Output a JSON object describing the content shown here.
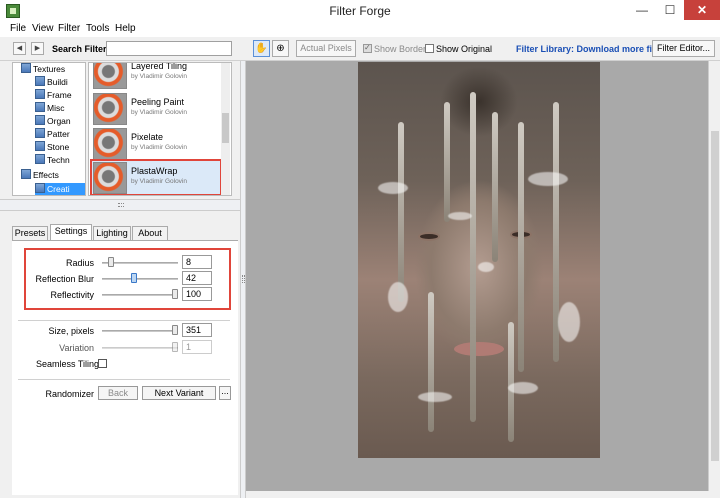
{
  "window": {
    "title": "Filter Forge",
    "minimize": "—",
    "maximize": "☐",
    "close": "✕"
  },
  "menu": [
    "File",
    "View",
    "Filter",
    "Tools",
    "Help"
  ],
  "toolbar": {
    "back_icon": "◀",
    "forward_icon": "▶",
    "search_label": "Search Filters:",
    "search_value": "",
    "hand_icon": "✋",
    "zoom_icon": "⊕",
    "actual_pixels": "Actual Pixels",
    "show_border": "Show Border",
    "show_border_checked": true,
    "show_original": "Show Original",
    "show_original_checked": false,
    "library_link": "Filter Library: Download more filters",
    "filter_editor": "Filter Editor..."
  },
  "tree": [
    {
      "label": "Textures",
      "level": 0
    },
    {
      "label": "Buildi",
      "level": 1
    },
    {
      "label": "Frame",
      "level": 1
    },
    {
      "label": "Misc",
      "level": 1
    },
    {
      "label": "Organ",
      "level": 1
    },
    {
      "label": "Patter",
      "level": 1
    },
    {
      "label": "Stone",
      "level": 1
    },
    {
      "label": "Techn",
      "level": 1
    },
    {
      "label": "Effects",
      "level": 0
    },
    {
      "label": "Creati",
      "level": 1,
      "selected": true
    }
  ],
  "filters": [
    {
      "name": "Layered Tiling",
      "author": "by Vladimir Golovin"
    },
    {
      "name": "Peeling Paint",
      "author": "by Vladimir Golovin"
    },
    {
      "name": "Pixelate",
      "author": "by Vladimir Golovin"
    },
    {
      "name": "PlastaWrap",
      "author": "by Vladimir Golovin",
      "selected": true
    }
  ],
  "tabs": [
    "Presets",
    "Settings",
    "Lighting",
    "About"
  ],
  "active_tab": "Settings",
  "settings": {
    "params": [
      {
        "label": "Radius",
        "value": "8",
        "level": 0.08
      },
      {
        "label": "Reflection Blur",
        "value": "42",
        "level": 0.42,
        "highlight": true
      },
      {
        "label": "Reflectivity",
        "value": "100",
        "level": 1.0
      }
    ],
    "size_label": "Size, pixels",
    "size_value": "351",
    "size_level": 1.0,
    "variation_label": "Variation",
    "variation_value": "1",
    "variation_level": 1.0,
    "seamless_label": "Seamless Tiling",
    "seamless_checked": false,
    "randomizer_label": "Randomizer",
    "back_button": "Back",
    "next_variant_button": "Next Variant",
    "more_button": "..."
  }
}
